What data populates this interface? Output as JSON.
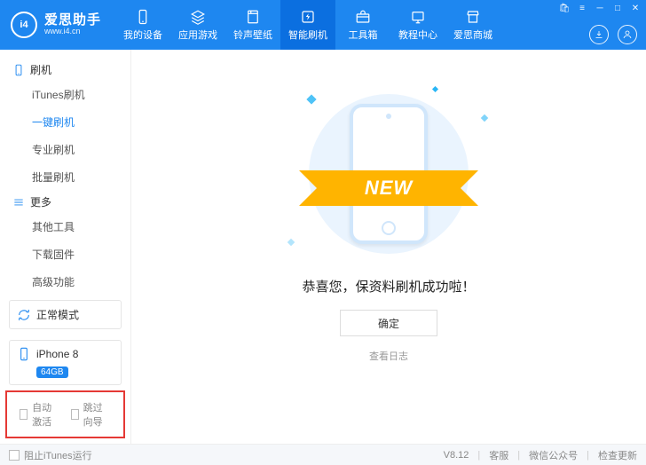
{
  "brand": {
    "name": "爱思助手",
    "site": "www.i4.cn",
    "logo_text": "i4"
  },
  "header_tabs": [
    {
      "label": "我的设备",
      "icon": "device"
    },
    {
      "label": "应用游戏",
      "icon": "apps"
    },
    {
      "label": "铃声壁纸",
      "icon": "ringtone"
    },
    {
      "label": "智能刷机",
      "icon": "flash",
      "active": true
    },
    {
      "label": "工具箱",
      "icon": "toolbox"
    },
    {
      "label": "教程中心",
      "icon": "tutorial"
    },
    {
      "label": "爱思商城",
      "icon": "store"
    }
  ],
  "sidebar": {
    "groups": [
      {
        "title": "刷机",
        "items": [
          "iTunes刷机",
          "一键刷机",
          "专业刷机",
          "批量刷机"
        ],
        "active_index": 1
      },
      {
        "title": "更多",
        "items": [
          "其他工具",
          "下载固件",
          "高级功能"
        ]
      }
    ],
    "mode_box": {
      "label": "正常模式"
    },
    "device_box": {
      "name": "iPhone 8",
      "storage": "64GB"
    },
    "bottom_checks": {
      "auto_activate": "自动激活",
      "skip_guide": "跳过向导"
    }
  },
  "main": {
    "ribbon_text": "NEW",
    "message": "恭喜您，保资料刷机成功啦！",
    "ok_button": "确定",
    "view_log": "查看日志"
  },
  "footer": {
    "block_itunes": "阻止iTunes运行",
    "version": "V8.12",
    "links": [
      "客服",
      "微信公众号",
      "检查更新"
    ]
  }
}
